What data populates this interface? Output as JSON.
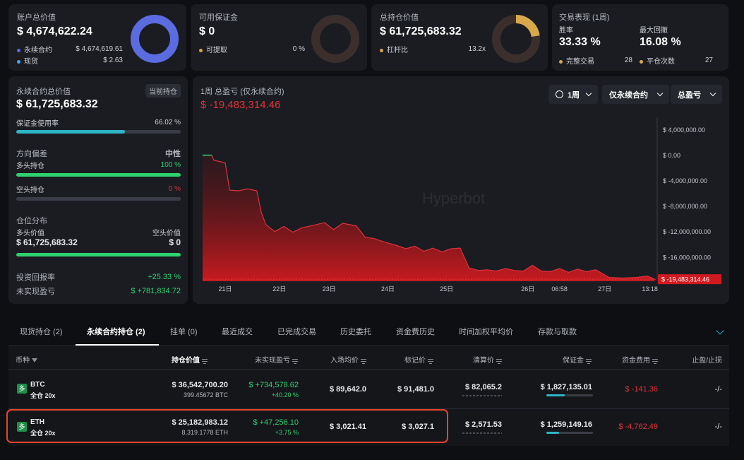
{
  "cards": {
    "account": {
      "label": "账户总价值",
      "value": "$ 4,674,622.24",
      "legend": [
        {
          "name": "永续合约",
          "value": "$ 4,674,619.61",
          "color": "#5b6be0"
        },
        {
          "name": "现货",
          "value": "$ 2.63",
          "color": "#4aa3f0"
        }
      ]
    },
    "margin": {
      "label": "可用保证金",
      "value": "$ 0",
      "legend": [
        {
          "name": "可提取",
          "value": "0 %",
          "color": "#d8a84a"
        }
      ]
    },
    "positions": {
      "label": "总持仓价值",
      "value": "$ 61,725,683.32",
      "legend": [
        {
          "name": "杠杆比",
          "value": "13.2x",
          "color": "#d8a84a"
        }
      ]
    },
    "performance": {
      "label": "交易表现 (1周)",
      "win_rate_label": "胜率",
      "win_rate": "33.33 %",
      "drawdown_label": "最大回撤",
      "drawdown": "16.08 %",
      "completed_label": "完整交易",
      "completed": "28",
      "closes_label": "平仓次数",
      "closes": "27"
    }
  },
  "perp_panel": {
    "label": "永续合约总价值",
    "badge": "当前持仓",
    "value": "$ 61,725,683.32",
    "margin_usage_label": "保证金使用率",
    "margin_usage": "66.02 %",
    "margin_usage_frac": 0.6602,
    "bias_label": "方向偏差",
    "bias_value": "中性",
    "long_label": "多头持仓",
    "long_pct": "100 %",
    "long_frac": 1.0,
    "short_label": "空头持仓",
    "short_pct": "0 %",
    "short_frac": 0,
    "dist_label": "仓位分布",
    "long_value_label": "多头价值",
    "long_value": "$ 61,725,683.32",
    "short_value_label": "空头价值",
    "short_value": "$ 0",
    "roi_label": "投资回报率",
    "roi": "+25.33 %",
    "upnl_label": "未实现盈亏",
    "upnl": "$ +781,834.72"
  },
  "pnl_chart": {
    "label": "1周 总盈亏 (仅永续合约)",
    "value": "$ -19,483,314.46",
    "controls": [
      "1周",
      "仅永续合约",
      "总盈亏"
    ],
    "watermark": "Hyperbot"
  },
  "chart_data": {
    "type": "area",
    "y_ticks": [
      "$ 4,000,000.00",
      "$ 0.00",
      "$ -4,000,000.00",
      "$ -8,000,000.00",
      "$ -12,000,000.00",
      "$ -16,000,000.00"
    ],
    "y_tick_values": [
      4000000,
      0,
      -4000000,
      -8000000,
      -12000000,
      -16000000
    ],
    "x_ticks": [
      "21日",
      "22日",
      "23日",
      "24日",
      "25日",
      "26日",
      "06:58",
      "27日",
      "13:18"
    ],
    "x_tick_pos": [
      0.05,
      0.17,
      0.28,
      0.41,
      0.54,
      0.72,
      0.79,
      0.89,
      0.99
    ],
    "current_label": "$ -19,483,314.46",
    "current_value": -19483314.46,
    "ylim": [
      5500000,
      -19800000
    ],
    "points": [
      [
        0.0,
        0
      ],
      [
        0.02,
        0
      ],
      [
        0.025,
        -800000
      ],
      [
        0.05,
        -1200000
      ],
      [
        0.06,
        -5500000
      ],
      [
        0.08,
        -5600000
      ],
      [
        0.1,
        -5300000
      ],
      [
        0.12,
        -5600000
      ],
      [
        0.13,
        -9000000
      ],
      [
        0.14,
        -10900000
      ],
      [
        0.16,
        -12000000
      ],
      [
        0.18,
        -11200000
      ],
      [
        0.2,
        -12100000
      ],
      [
        0.22,
        -11400000
      ],
      [
        0.24,
        -11100000
      ],
      [
        0.27,
        -10600000
      ],
      [
        0.29,
        -11700000
      ],
      [
        0.31,
        -10700000
      ],
      [
        0.34,
        -11100000
      ],
      [
        0.36,
        -12900000
      ],
      [
        0.38,
        -13100000
      ],
      [
        0.4,
        -13600000
      ],
      [
        0.43,
        -14200000
      ],
      [
        0.45,
        -14700000
      ],
      [
        0.47,
        -14300000
      ],
      [
        0.49,
        -15100000
      ],
      [
        0.51,
        -14600000
      ],
      [
        0.53,
        -15200000
      ],
      [
        0.55,
        -14700000
      ],
      [
        0.57,
        -14600000
      ],
      [
        0.59,
        -17700000
      ],
      [
        0.61,
        -18100000
      ],
      [
        0.63,
        -18000000
      ],
      [
        0.65,
        -18200000
      ],
      [
        0.67,
        -17800000
      ],
      [
        0.69,
        -18100000
      ],
      [
        0.71,
        -18200000
      ],
      [
        0.73,
        -17300000
      ],
      [
        0.75,
        -18200000
      ],
      [
        0.77,
        -18300000
      ],
      [
        0.79,
        -17800000
      ],
      [
        0.81,
        -18400000
      ],
      [
        0.83,
        -17900000
      ],
      [
        0.85,
        -18300000
      ],
      [
        0.87,
        -18000000
      ],
      [
        0.9,
        -19200000
      ],
      [
        0.93,
        -19300000
      ],
      [
        0.96,
        -19200000
      ],
      [
        0.985,
        -19000000
      ],
      [
        1.0,
        -19483314.46
      ]
    ]
  },
  "tabs": [
    {
      "label": "现货持仓 (2)"
    },
    {
      "label": "永续合约持仓 (2)"
    },
    {
      "label": "挂单 (0)"
    },
    {
      "label": "最近成交"
    },
    {
      "label": "已完成交易"
    },
    {
      "label": "历史委托"
    },
    {
      "label": "资金费历史"
    },
    {
      "label": "时间加权平均价"
    },
    {
      "label": "存款与取款"
    }
  ],
  "table": {
    "headers": [
      "币种",
      "持仓价值",
      "未实现盈亏",
      "入场均价",
      "标记价",
      "清算价",
      "保证金",
      "资金费用",
      "止盈/止损"
    ],
    "rows": [
      {
        "side": "多",
        "coin": "BTC",
        "mode": "全仓 20x",
        "value": "$ 36,542,700.20",
        "size": "399.45672 BTC",
        "upnl": "$ +734,578.62",
        "upnl_pct": "+40.20 %",
        "entry": "$ 89,642.0",
        "mark": "$ 91,481.0",
        "liq": "$ 82,065.2",
        "margin": "$ 1,827,135.01",
        "margin_frac": 0.4,
        "funding": "$ -141.36",
        "tpsl": "-/-"
      },
      {
        "side": "多",
        "coin": "ETH",
        "mode": "全仓 20x",
        "value": "$ 25,182,983.12",
        "size": "8,319.1778 ETH",
        "upnl": "$ +47,256.10",
        "upnl_pct": "+3.75 %",
        "entry": "$ 3,021.41",
        "mark": "$ 3,027.1",
        "liq": "$ 2,571.53",
        "margin": "$ 1,259,149.16",
        "margin_frac": 0.28,
        "funding": "$ -4,762.49",
        "tpsl": "-/-"
      }
    ]
  }
}
